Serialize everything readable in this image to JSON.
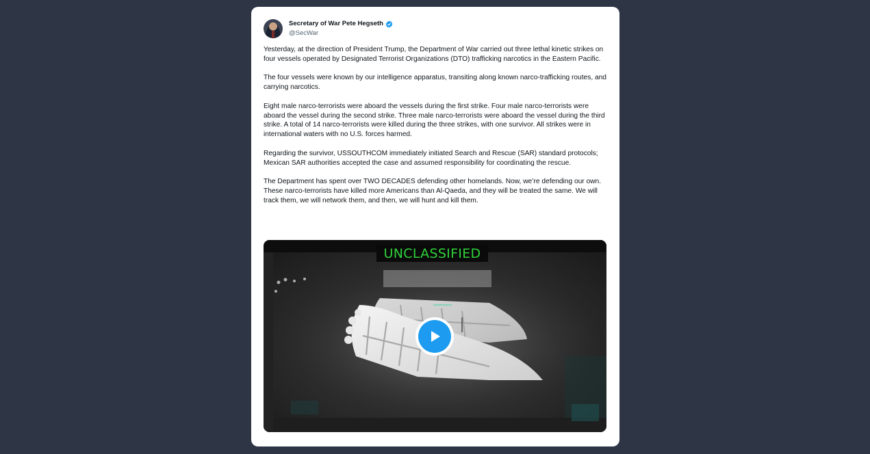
{
  "post": {
    "author": {
      "display_name": "Secretary of War Pete Hegseth",
      "handle": "@SecWar",
      "verified": true,
      "avatar_icon": "profile-photo"
    },
    "paragraphs": [
      "Yesterday, at the direction of President Trump, the Department of War carried out three lethal kinetic strikes on four vessels operated by Designated Terrorist Organizations (DTO) trafficking narcotics in the Eastern Pacific.",
      "The four vessels were known by our intelligence apparatus, transiting along known narco-trafficking routes, and carrying narcotics.",
      "Eight male narco-terrorists were aboard the vessels during the first strike. Four male narco-terrorists were aboard the vessel during the second strike. Three male narco-terrorists were aboard the vessel during the third strike. A total of 14 narco-terrorists were killed during the three strikes, with one survivor. All strikes were in international waters with no U.S. forces harmed.",
      "Regarding the survivor, USSOUTHCOM immediately initiated Search and Rescue (SAR) standard protocols; Mexican SAR authorities accepted the case and assumed responsibility for coordinating the rescue.",
      "The Department has spent over TWO DECADES defending other homelands. Now, we’re defending our own. These narco-terrorists have killed more Americans than Al-Qaeda, and they will be treated the same. We will track them, we will network them, and then, we will hunt and kill them."
    ],
    "media": {
      "type": "video",
      "overlay_label": "UNCLASSIFIED",
      "play_icon": "play-icon",
      "accent_color": "#1d9bf0",
      "label_color": "#2fd23a"
    }
  },
  "colors": {
    "page_background": "#2e3545",
    "card_background": "#ffffff",
    "verified_badge": "#1d9bf0",
    "text_primary": "#0f1419",
    "text_secondary": "#536471"
  }
}
